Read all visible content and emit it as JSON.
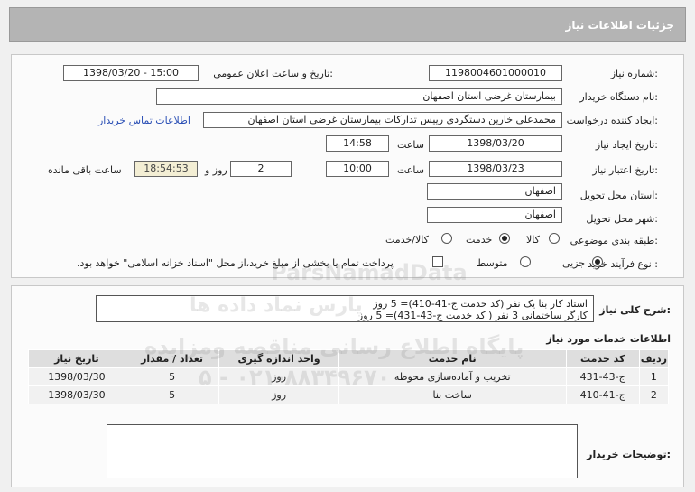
{
  "header": {
    "title": "جزئیات اطلاعات نیاز"
  },
  "form": {
    "need_number_label": "شماره نیاز:",
    "need_number": "1198004601000010",
    "announce_label": "تاریخ و ساعت اعلان عمومی:",
    "announce_value": "1398/03/20 - 15:00",
    "buyer_org_label": "نام دستگاه خریدار:",
    "buyer_org": "بیمارستان غرضی استان اصفهان",
    "creator_label": "ایجاد کننده درخواست:",
    "creator": "محمدعلی خارین دستگردی رییس تدارکات بیمارستان غرضی استان اصفهان",
    "contact_link": "اطلاعات تماس خریدار",
    "create_date_label": "تاریخ ایجاد نیاز:",
    "create_date": "1398/03/20",
    "create_time_label": "ساعت",
    "create_time": "14:58",
    "validity_label": "تاریخ اعتبار نیاز:",
    "validity_date": "1398/03/23",
    "validity_time_label": "ساعت",
    "validity_time": "10:00",
    "days": "2",
    "days_label": "روز و",
    "remaining": "18:54:53",
    "remaining_label": "ساعت باقی مانده",
    "province_label": "استان محل تحویل:",
    "province": "اصفهان",
    "city_label": "شهر محل تحویل:",
    "city": "اصفهان",
    "category_label": "طبقه بندی موضوعی:",
    "cat_goods": "کالا",
    "cat_service": "خدمت",
    "cat_goods_service": "کالا/خدمت",
    "purchase_type_label": "نوع فرآیند خرید :",
    "pt_partial": "جزیی",
    "pt_medium": "متوسط",
    "payment_note": "پرداخت تمام یا بخشی از مبلغ خرید،از محل \"اسناد خزانه اسلامی\" خواهد بود."
  },
  "summary": {
    "label": "شرح کلی نیاز:",
    "line1": "استاد کار بنا یک نفر  (کد خدمت ج-41-410)= 5 روز",
    "line2": "کارگر ساختمانی 3 نفر ( کد خدمت ج-43-431)= 5 روز"
  },
  "services": {
    "title": "اطلاعات خدمات مورد نیاز",
    "headers": [
      "ردیف",
      "کد خدمت",
      "نام خدمت",
      "واحد اندازه گیری",
      "تعداد / مقدار",
      "تاریخ نیاز"
    ],
    "rows": [
      [
        "1",
        "ج-43-431",
        "تخریب و آماده‌سازی محوطه",
        "روز",
        "5",
        "1398/03/30"
      ],
      [
        "2",
        "ج-41-410",
        "ساخت بنا",
        "روز",
        "5",
        "1398/03/30"
      ]
    ]
  },
  "buyer_notes_label": "توضیحات خریدار:",
  "watermark": {
    "brand": "ParsNamadData",
    "line1": "پارس نماد داده ها",
    "line2": "پایگاه اطلاع رسانی مناقصه ومزایده",
    "line3": "۰۲۱-۸۸۳۴۹۶۷۰ - ۵"
  }
}
